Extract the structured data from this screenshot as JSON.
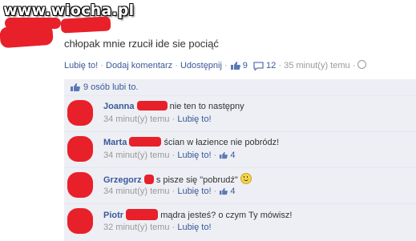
{
  "watermark": "www.wiocha.pl",
  "post": {
    "text": "chłopak mnie rzucił ide sie pociąć",
    "like_link": "Lubię to!",
    "comment_link": "Dodaj komentarz",
    "share_link": "Udostępnij",
    "like_count": "9",
    "comment_count": "12",
    "time": "35 minut(y) temu",
    "separator": "·"
  },
  "likes_summary": "9 osób lubi to.",
  "comments": [
    {
      "author": "Joanna",
      "text": "nie ten to następny",
      "time": "34 minut(y) temu",
      "like_link": "Lubię to!",
      "likes": ""
    },
    {
      "author": "Marta",
      "text": "ścian w łazience nie pobródz!",
      "time": "34 minut(y) temu",
      "like_link": "Lubię to!",
      "likes": "4"
    },
    {
      "author": "Grzegorz",
      "text": "s pisze się \"pobrudź\"",
      "time": "34 minut(y) temu",
      "like_link": "Lubię to!",
      "likes": "4"
    },
    {
      "author": "Piotr",
      "text": "mądra jesteś? o czym Ty mówisz!",
      "time": "32 minut(y) temu",
      "like_link": "Lubię to!",
      "likes": ""
    }
  ],
  "colors": {
    "link": "#3b5998",
    "censor": "#e8202a",
    "box_bg": "#edeff4"
  }
}
